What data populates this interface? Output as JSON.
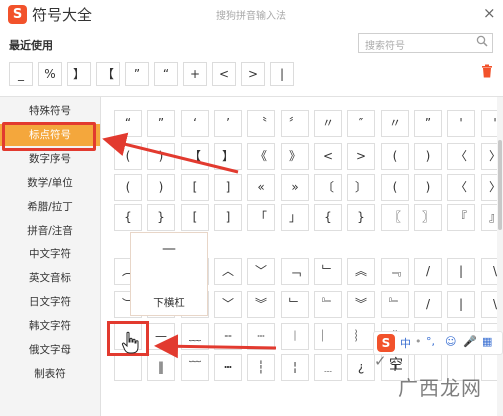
{
  "window": {
    "title": "符号大全",
    "ime_title": "搜狗拼音输入法",
    "logo_text": "S",
    "close_glyph": "×"
  },
  "recent": {
    "label": "最近使用",
    "symbols": [
      "_",
      "%",
      "】",
      "【",
      "”",
      "“",
      "+",
      "<",
      ">",
      "|"
    ]
  },
  "search": {
    "placeholder": "搜索符号",
    "icon": "search-icon"
  },
  "sidebar": {
    "items": [
      {
        "label": "特殊符号"
      },
      {
        "label": "标点符号",
        "active": true
      },
      {
        "label": "数字序号"
      },
      {
        "label": "数学/单位"
      },
      {
        "label": "希腊/拉丁"
      },
      {
        "label": "拼音/注音"
      },
      {
        "label": "中文字符"
      },
      {
        "label": "英文音标"
      },
      {
        "label": "日文字符"
      },
      {
        "label": "韩文字符"
      },
      {
        "label": "俄文字母"
      },
      {
        "label": "制表符"
      }
    ]
  },
  "grid": {
    "rows": [
      [
        "“",
        "”",
        "‘",
        "’",
        "〝",
        "〞",
        "〃",
        "″",
        "〃",
        "”",
        "'",
        "'"
      ],
      [
        "(",
        ")",
        "【",
        "】",
        "《",
        "》",
        "<",
        ">",
        "(",
        ")",
        "〈",
        "〉"
      ],
      [
        "(",
        ")",
        "[",
        "]",
        "«",
        "»",
        "〔",
        "〕",
        "(",
        ")",
        "〈",
        "〉"
      ],
      [
        "{",
        "}",
        "[",
        "]",
        "「",
        "」",
        "{",
        "}",
        "〖",
        "〗",
        "『",
        "』"
      ],
      [
        "︵",
        "",
        "",
        "︿",
        "﹀",
        "﹁",
        "﹂",
        "︽",
        "﹃",
        "/",
        "|",
        "\\"
      ],
      [
        "︶",
        "",
        "",
        "﹀",
        "︾",
        "﹂",
        "﹄",
        "︾",
        "﹄",
        "/",
        "|",
        "\\"
      ],
      [
        "",
        "—",
        "﹏",
        "╌",
        "┄",
        "︱",
        "︳",
        "︴",
        "ˇ",
        "",
        "",
        ""
      ],
      [
        "",
        "‖",
        "﹋",
        "┅",
        "┆",
        "¦",
        "﹍",
        "¿",
        "i",
        "",
        "",
        ""
      ]
    ]
  },
  "tooltip": {
    "symbol": "—",
    "name": "下横杠"
  },
  "ime_bar": {
    "logo_text": "S",
    "items": [
      "中",
      "•",
      "°,",
      "☺",
      "🎤",
      "▦"
    ]
  },
  "partial_text": {
    "kong": "空"
  },
  "watermark": {
    "text": "广西龙网",
    "mark": "✓"
  },
  "colors": {
    "active_tab": "#f4a73c",
    "annotation_red": "#e23a2f",
    "logo": "#f2522b",
    "ime_blue": "#3a6fd2"
  }
}
